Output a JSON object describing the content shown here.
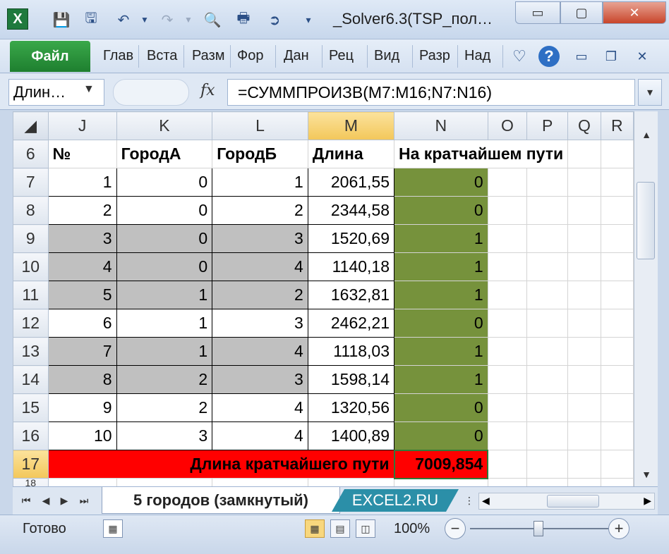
{
  "window": {
    "title": "_Solver6.3(TSP_пол…",
    "min_glyph": "▭",
    "max_glyph": "▢",
    "close_glyph": "✕"
  },
  "quick_access": {
    "app_icon": "excel-icon",
    "app_letter": "X"
  },
  "ribbon": {
    "file_tab": "Файл",
    "tabs": [
      "Глав",
      "Вста",
      "Разм",
      "Фор",
      "Дан",
      "Рец",
      "Вид",
      "Разр",
      "Над"
    ],
    "help_glyph": "?"
  },
  "formula_bar": {
    "name_box": "Длин…",
    "fx": "fx",
    "formula": "=СУММПРОИЗВ(M7:M16;N7:N16)"
  },
  "grid": {
    "columns": [
      "J",
      "K",
      "L",
      "M",
      "N",
      "O",
      "P",
      "Q",
      "R"
    ],
    "selected_column": "M",
    "header_row": {
      "row": "6",
      "cells": [
        "№",
        "ГородА",
        "ГородБ",
        "Длина",
        "На кратчайшем пути"
      ]
    },
    "rows": [
      {
        "row": "7",
        "n": "1",
        "a": "0",
        "b": "1",
        "len": "2061,55",
        "on": "0",
        "gray": false
      },
      {
        "row": "8",
        "n": "2",
        "a": "0",
        "b": "2",
        "len": "2344,58",
        "on": "0",
        "gray": false
      },
      {
        "row": "9",
        "n": "3",
        "a": "0",
        "b": "3",
        "len": "1520,69",
        "on": "1",
        "gray": true
      },
      {
        "row": "10",
        "n": "4",
        "a": "0",
        "b": "4",
        "len": "1140,18",
        "on": "1",
        "gray": true
      },
      {
        "row": "11",
        "n": "5",
        "a": "1",
        "b": "2",
        "len": "1632,81",
        "on": "1",
        "gray": true
      },
      {
        "row": "12",
        "n": "6",
        "a": "1",
        "b": "3",
        "len": "2462,21",
        "on": "0",
        "gray": false
      },
      {
        "row": "13",
        "n": "7",
        "a": "1",
        "b": "4",
        "len": "1118,03",
        "on": "1",
        "gray": true
      },
      {
        "row": "14",
        "n": "8",
        "a": "2",
        "b": "3",
        "len": "1598,14",
        "on": "1",
        "gray": true
      },
      {
        "row": "15",
        "n": "9",
        "a": "2",
        "b": "4",
        "len": "1320,56",
        "on": "0",
        "gray": false
      },
      {
        "row": "16",
        "n": "10",
        "a": "3",
        "b": "4",
        "len": "1400,89",
        "on": "0",
        "gray": false
      }
    ],
    "total_row": {
      "row": "17",
      "label": "Длина кратчайшего пути",
      "value": "7009,854"
    },
    "next_row": "18"
  },
  "sheets": {
    "active": "5 городов (замкнутый)",
    "other": "EXCEL2.RU"
  },
  "status": {
    "text": "Готово",
    "zoom": "100%",
    "zoom_out": "−",
    "zoom_in": "+"
  },
  "colors": {
    "green_cells": "#76923c",
    "red_cells": "#ff0000",
    "gray_rows": "#c0c0c0",
    "file_tab": "#1e7f2f"
  }
}
